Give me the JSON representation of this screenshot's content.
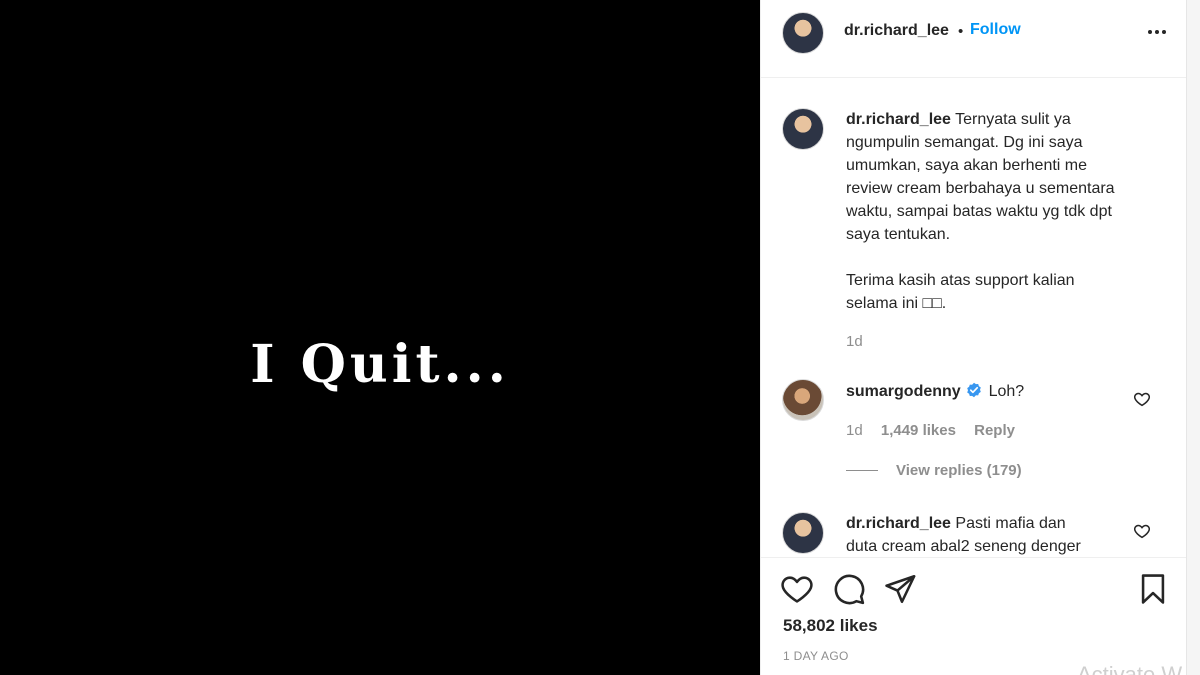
{
  "media": {
    "text": "I Quit..."
  },
  "post": {
    "username": "dr.richard_lee",
    "dot": "•",
    "follow_label": "Follow",
    "more_icon": "more-horizontal-icon"
  },
  "caption": {
    "username": "dr.richard_lee",
    "lines": [
      "Ternyata sulit ya",
      "ngumpulin semangat. Dg ini saya",
      "umumkan, saya akan berhenti me",
      "review cream berbahaya u sementara",
      "waktu, sampai batas waktu yg tdk dpt",
      "saya tentukan.",
      "",
      "Terima kasih atas support kalian",
      "selama ini □□."
    ],
    "time": "1d"
  },
  "comments": [
    {
      "username": "sumargodenny",
      "verified": true,
      "text": "Loh?",
      "time": "1d",
      "likes": "1,449 likes",
      "reply_label": "Reply",
      "view_replies": "View replies (179)"
    },
    {
      "username": "dr.richard_lee",
      "lines": [
        "Pasti mafia dan",
        "duta cream abal2 seneng denger"
      ]
    }
  ],
  "actions": {
    "likes": "58,802 likes",
    "date": "1 DAY AGO",
    "watermark": "Activate W"
  },
  "colors": {
    "accent": "#0095f6",
    "verified": "#3897f0",
    "text": "#262626",
    "muted": "#8e8e8e",
    "media_bg": "#000000"
  }
}
